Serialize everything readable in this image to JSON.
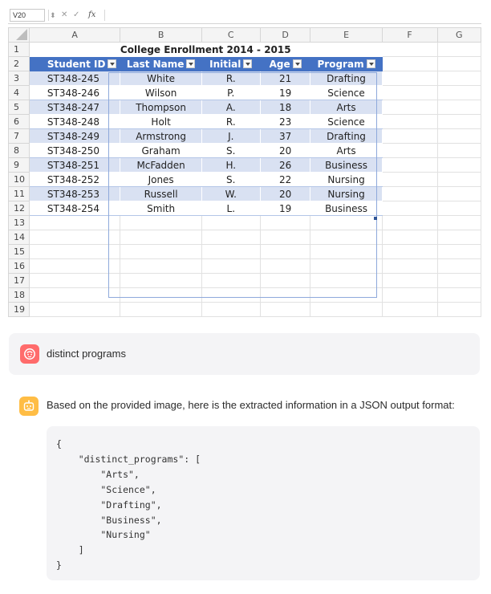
{
  "spreadsheet": {
    "name_box": "V20",
    "formula_fx": "fx",
    "columns": [
      "A",
      "B",
      "C",
      "D",
      "E",
      "F",
      "G"
    ],
    "rows": [
      "1",
      "2",
      "3",
      "4",
      "5",
      "6",
      "7",
      "8",
      "9",
      "10",
      "11",
      "12",
      "13",
      "14",
      "15",
      "16",
      "17",
      "18",
      "19"
    ],
    "table_title": "College Enrollment 2014 - 2015",
    "headers": [
      "Student ID",
      "Last Name",
      "Initial",
      "Age",
      "Program"
    ],
    "records": [
      [
        "ST348-245",
        "White",
        "R.",
        "21",
        "Drafting"
      ],
      [
        "ST348-246",
        "Wilson",
        "P.",
        "19",
        "Science"
      ],
      [
        "ST348-247",
        "Thompson",
        "A.",
        "18",
        "Arts"
      ],
      [
        "ST348-248",
        "Holt",
        "R.",
        "23",
        "Science"
      ],
      [
        "ST348-249",
        "Armstrong",
        "J.",
        "37",
        "Drafting"
      ],
      [
        "ST348-250",
        "Graham",
        "S.",
        "20",
        "Arts"
      ],
      [
        "ST348-251",
        "McFadden",
        "H.",
        "26",
        "Business"
      ],
      [
        "ST348-252",
        "Jones",
        "S.",
        "22",
        "Nursing"
      ],
      [
        "ST348-253",
        "Russell",
        "W.",
        "20",
        "Nursing"
      ],
      [
        "ST348-254",
        "Smith",
        "L.",
        "19",
        "Business"
      ]
    ],
    "header_color": "#4472c4",
    "band_color": "#d9e1f2"
  },
  "chat": {
    "user_message": "distinct programs",
    "assistant_intro": "Based on the provided image, here is the extracted information in a JSON output format:",
    "code": "{\n    \"distinct_programs\": [\n        \"Arts\",\n        \"Science\",\n        \"Drafting\",\n        \"Business\",\n        \"Nursing\"\n    ]\n}",
    "user_avatar_color": "#ff6b6b",
    "assistant_avatar_color": "#ffbd45"
  }
}
